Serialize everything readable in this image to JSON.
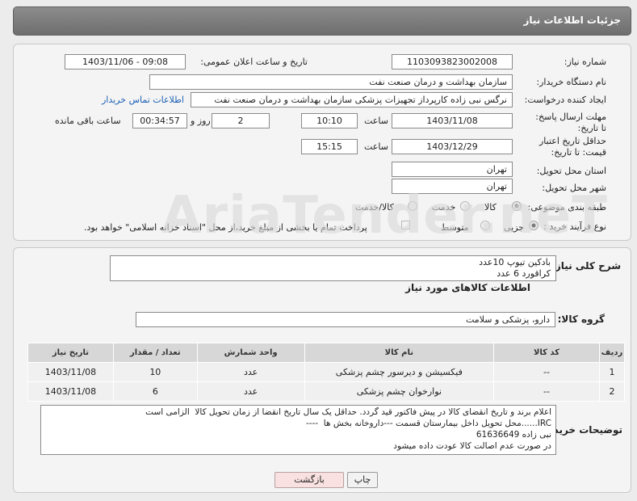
{
  "header": {
    "title": "جزئیات اطلاعات نیاز"
  },
  "form": {
    "need_number_label": "شماره نیاز:",
    "need_number": "1103093823002008",
    "announce_label": "تاریخ و ساعت اعلان عمومی:",
    "announce_value": "1403/11/06 - 09:08",
    "buyer_org_label": "نام دستگاه خریدار:",
    "buyer_org": "سازمان بهداشت و درمان صنعت نفت",
    "creator_label": "ایجاد کننده درخواست:",
    "creator": "نرگس نبی زاده کارپرداز تجهیزات پزشکی سازمان بهداشت و درمان صنعت نفت",
    "contact_link": "اطلاعات تماس خریدار",
    "deadline_label": "مهلت ارسال پاسخ: تا تاریخ:",
    "deadline_date": "1403/11/08",
    "time_label": "ساعت",
    "deadline_time": "10:10",
    "days_value": "2",
    "days_label": "روز و",
    "remaining_time": "00:34:57",
    "remaining_label": "ساعت باقی مانده",
    "price_validity_label": "حداقل تاریخ اعتبار قیمت: تا تاریخ:",
    "price_validity_date": "1403/12/29",
    "price_validity_time": "15:15",
    "province_label": "استان محل تحویل:",
    "province": "تهران",
    "city_label": "شهر محل تحویل:",
    "city": "تهران",
    "category_label": "طبقه بندی موضوعی:",
    "category_options": [
      "کالا",
      "خدمت",
      "کالا/خدمت"
    ],
    "process_label": "نوع فرآیند خرید :",
    "process_options": [
      "جزیی",
      "متوسط"
    ],
    "payment_note": "پرداخت تمام یا بخشی از مبلغ خرید،از محل \"اسناد خزانه اسلامی\" خواهد بود."
  },
  "summary": {
    "label": "شرح کلی نیاز:",
    "text": "بادکین تیوپ 10عدد\nکراقورد 6 عدد"
  },
  "goods": {
    "section_title": "اطلاعات کالاهای مورد نیاز",
    "group_label": "گروه کالا:",
    "group_value": "دارو، پزشکی و سلامت",
    "columns": [
      "ردیف",
      "کد کالا",
      "نام کالا",
      "واحد شمارش",
      "تعداد / مقدار",
      "تاریخ نیاز"
    ],
    "rows": [
      {
        "row": "1",
        "code": "--",
        "name": "فیکسیشن و دیرسور چشم پزشکی",
        "unit": "عدد",
        "qty": "10",
        "date": "1403/11/08"
      },
      {
        "row": "2",
        "code": "--",
        "name": "نوارخوان چشم پزشکی",
        "unit": "عدد",
        "qty": "6",
        "date": "1403/11/08"
      }
    ]
  },
  "buyer_notes": {
    "label": "توضیحات خریدار:",
    "text": "اعلام برند و تاریخ انقضای کالا در پیش فاکتور قید گردد. حداقل یک سال تاریخ انقضا از زمان تحویل کالا  الزامی است\nIRC......محل تحویل داخل بیمارستان قسمت ---داروخانه بخش ها  ----\nنبی زاده 61636649\nدر صورت عدم اصالت کالا عودت داده میشود"
  },
  "buttons": {
    "print": "چاپ",
    "back": "بازگشت"
  },
  "watermark": {
    "text": "AriaTender.neT"
  }
}
